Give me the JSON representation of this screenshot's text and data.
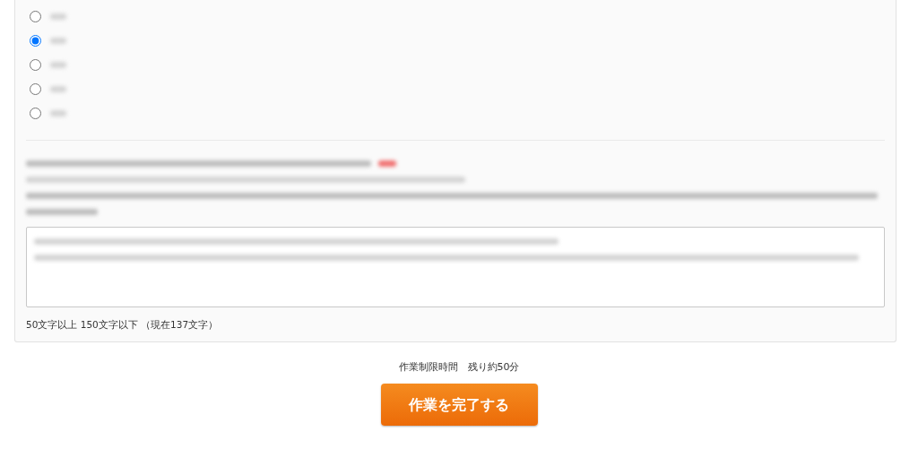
{
  "rating_options": [
    {
      "selected": false
    },
    {
      "selected": true
    },
    {
      "selected": false
    },
    {
      "selected": false
    },
    {
      "selected": false
    }
  ],
  "char_count": "50文字以上 150文字以下 （現在137文字）",
  "time_limit": "作業制限時間　残り約50分",
  "submit_button": "作業を完了する"
}
